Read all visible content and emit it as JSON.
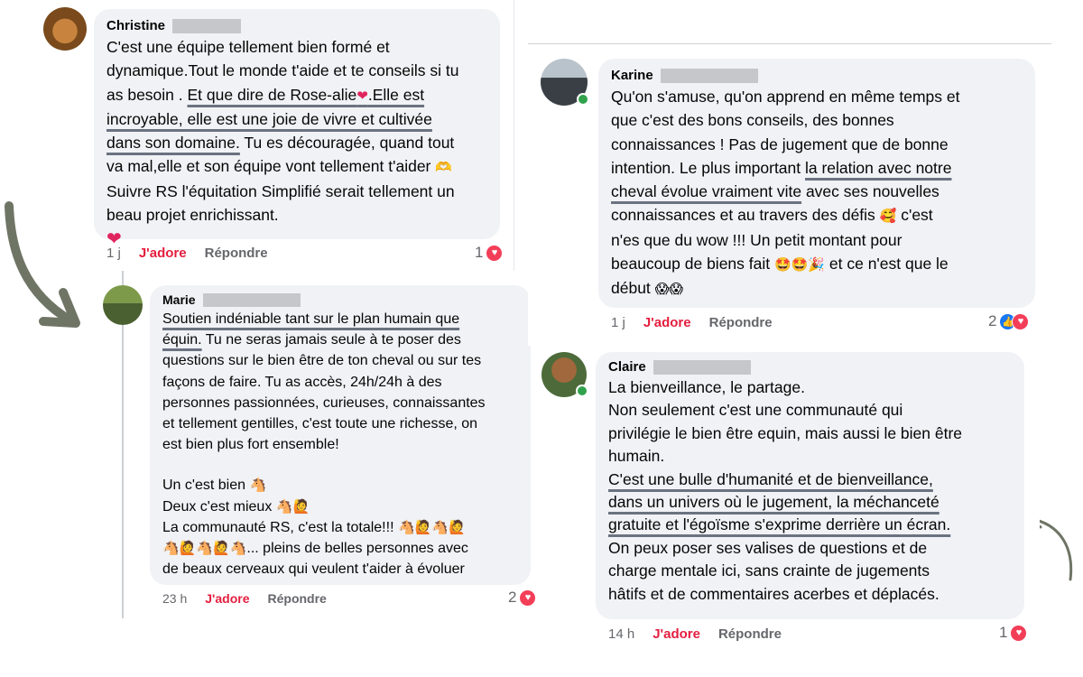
{
  "comments": {
    "christine": {
      "author": "Christine",
      "lines": [
        "C'est une équipe tellement bien formé et",
        "dynamique.Tout le monde t'aide et te conseils si tu",
        "as besoin . ",
        "Et que dire de Rose-alie",
        ".Elle est",
        "incroyable, elle est une joie de vivre et cultivée",
        "dans son domaine.",
        " Tu es découragée, quand tout",
        "va mal,elle et son équipe vont tellement t'aider",
        "Suivre RS l'équitation Simplifié serait tellement un",
        "beau projet enrichissant."
      ],
      "time": "1 j",
      "like_label": "J'adore",
      "reply_label": "Répondre",
      "reaction_count": "1"
    },
    "marie": {
      "author": "Marie",
      "lines": [
        "Soutien indéniable tant sur le plan humain que",
        "équin.",
        " Tu ne seras jamais seule à te poser des",
        "questions sur le bien être de ton cheval ou sur tes",
        "façons de faire. Tu as accès, 24h/24h à des",
        "personnes passionnées, curieuses, connaissantes",
        "et tellement gentilles, c'est toute une richesse, on",
        "est bien plus fort ensemble!",
        "Un c'est bien",
        "Deux c'est mieux",
        "La communauté RS, c'est la totale!!!",
        "... pleins de belles personnes avec",
        "de beaux cerveaux qui veulent t'aider à évoluer"
      ],
      "time": "23 h",
      "like_label": "J'adore",
      "reply_label": "Répondre",
      "reaction_count": "2"
    },
    "karine": {
      "author": "Karine",
      "lines": [
        "Qu'on s'amuse, qu'on apprend en même temps et",
        "que c'est des bons conseils, des bonnes",
        "connaissances !  Pas de jugement que de bonne",
        "intention. Le plus important ",
        "la relation avec notre",
        "cheval évolue vraiment vite",
        " avec ses nouvelles",
        "connaissances et au travers des défis",
        " c'est",
        "n'es que du wow !!! Un petit montant pour",
        "beaucoup de biens fait",
        " et ce n'est que le",
        "début"
      ],
      "time": "1 j",
      "like_label": "J'adore",
      "reply_label": "Répondre",
      "reaction_count": "2"
    },
    "claire": {
      "author": "Claire",
      "lines": [
        "La bienveillance, le partage.",
        "Non seulement c'est une communauté qui",
        "privilégie le bien être equin, mais aussi le bien être",
        "humain.",
        "C'est une bulle d'humanité et de bienveillance,",
        "dans un univers où le jugement, la méchanceté",
        "gratuite et l'égoïsme s'exprime derrière un écran.",
        "On peux poser ses valises de questions et de",
        "charge mentale ici, sans crainte de jugements",
        "hâtifs et de commentaires acerbes et déplacés."
      ],
      "time": "14 h",
      "like_label": "J'adore",
      "reply_label": "Répondre",
      "reaction_count": "1"
    }
  },
  "icons": {
    "heart": "heart-icon",
    "like": "like-icon",
    "online": "online-status-icon"
  },
  "colors": {
    "like_red": "#e41e3f",
    "heart_bg": "#f33e58",
    "like_blue": "#1877f2",
    "bubble_bg": "#f0f2f5",
    "online_green": "#31a24c",
    "underline_grey": "#6b7280",
    "arrow_grey": "#6f7565"
  }
}
